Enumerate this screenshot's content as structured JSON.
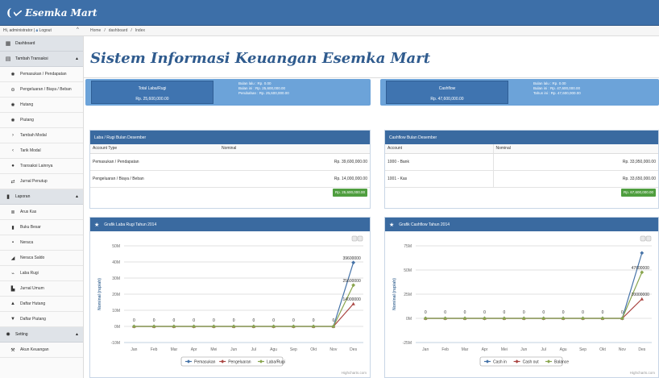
{
  "brand": {
    "bracket": "(",
    "name": "Esemka Mart"
  },
  "topbar": {
    "user_prefix": "Hi, administrator |",
    "logout": "Logout",
    "breadcrumb": [
      "Home",
      "dashboard",
      "Index"
    ]
  },
  "sidebar": {
    "items": [
      {
        "label": "Dashboard",
        "icon": "dashboard-icon",
        "glyph": "▦",
        "kind": "header"
      },
      {
        "label": "Tambah Transaksi",
        "icon": "document-icon",
        "glyph": "▤",
        "kind": "header",
        "caret": "▲"
      },
      {
        "label": "Pemasukan / Pendapatan",
        "icon": "gear-icon",
        "glyph": "✺",
        "kind": "sub"
      },
      {
        "label": "Pengeluaran / Biaya / Beban",
        "icon": "minus-circle-icon",
        "glyph": "⊖",
        "kind": "sub"
      },
      {
        "label": "Hutang",
        "icon": "gear-icon",
        "glyph": "✺",
        "kind": "sub"
      },
      {
        "label": "Piutang",
        "icon": "gear-icon",
        "glyph": "✺",
        "kind": "sub"
      },
      {
        "label": "Tambah Modal",
        "icon": "chevron-right-icon",
        "glyph": "›",
        "kind": "sub"
      },
      {
        "label": "Tarik Modal",
        "icon": "chevron-left-icon",
        "glyph": "‹",
        "kind": "sub"
      },
      {
        "label": "Transaksi Lainnya",
        "icon": "info-circle-icon",
        "glyph": "●",
        "kind": "sub"
      },
      {
        "label": "Jurnal Penutup",
        "icon": "exchange-icon",
        "glyph": "⇄",
        "kind": "sub"
      },
      {
        "label": "Laporan",
        "icon": "document-icon",
        "glyph": "▮",
        "kind": "header",
        "caret": "▲"
      },
      {
        "label": "Arus Kas",
        "icon": "list-icon",
        "glyph": "≣",
        "kind": "sub"
      },
      {
        "label": "Buku Besar",
        "icon": "book-icon",
        "glyph": "▮",
        "kind": "sub"
      },
      {
        "label": "Neraca",
        "icon": "balance-icon",
        "glyph": "▪",
        "kind": "sub"
      },
      {
        "label": "Neraca Saldo",
        "icon": "area-chart-icon",
        "glyph": "◢",
        "kind": "sub"
      },
      {
        "label": "Laba Rugi",
        "icon": "line-chart-icon",
        "glyph": "⌁",
        "kind": "sub"
      },
      {
        "label": "Jurnal Umum",
        "icon": "file-icon",
        "glyph": "▙",
        "kind": "sub"
      },
      {
        "label": "Daftar Hutang",
        "icon": "chevron-up-icon",
        "glyph": "▲",
        "kind": "sub"
      },
      {
        "label": "Daftar Piutang",
        "icon": "chevron-down-icon",
        "glyph": "▼",
        "kind": "sub"
      },
      {
        "label": "Setting",
        "icon": "gear-icon",
        "glyph": "✹",
        "kind": "header",
        "caret": "▲"
      },
      {
        "label": "Akun Keuangan",
        "icon": "tools-icon",
        "glyph": "⚒",
        "kind": "sub"
      }
    ]
  },
  "main": {
    "title": "Sistem Informasi Keuangan Esemka Mart"
  },
  "summary_labarugi": {
    "title": "Total Laba/Rugi",
    "value": "Rp. 25,600,000.00",
    "details": [
      "Bulan lalu : Rp. 0.00",
      "Bulan ini : Rp. 25,600,000.00",
      "Perubahan : Rp. 25,600,000.00"
    ]
  },
  "summary_cashflow": {
    "title": "Cashflow",
    "value": "Rp. 47,600,000.00",
    "details": [
      "Bulan lalu : Rp. 0.00",
      "Bulan ini : Rp. 47,600,000.00",
      "Tahun ini : Rp. 47,600,000.00"
    ]
  },
  "labarugi_table": {
    "heading": "Laba / Rugi Bulan Desember",
    "columns": [
      "Account Type",
      "Nominal"
    ],
    "rows": [
      {
        "account": "Pemasukan / Pendapatan",
        "nominal": "Rp. 39,600,000.00"
      },
      {
        "account": "Pengeluaran / Biaya / Beban",
        "nominal": "Rp. 14,000,000.00"
      }
    ],
    "total": "Rp. 25,600,000.00"
  },
  "cashflow_table": {
    "heading": "Cashflow Bulan Desember",
    "columns": [
      "Account",
      "Nominal"
    ],
    "rows": [
      {
        "account": "1000 - Bank",
        "nominal": "Rp. 33,950,000.00"
      },
      {
        "account": "1001 - Kas",
        "nominal": "Rp. 33,650,000.00"
      }
    ],
    "total": "Rp. 67,600,000.00"
  },
  "chart_labarugi_heading": "Grafik Laba Rugi Tahun 2014",
  "chart_cashflow_heading": "Grafik Cashflow Tahun 2014",
  "colors": {
    "series_blue": "#4572a7",
    "series_red": "#aa4643",
    "series_green": "#89a54e",
    "header_blue": "#3a6aa0"
  },
  "chart_data": [
    {
      "type": "line",
      "title": "",
      "xlabel": "",
      "ylabel": "Nominal (rupiah)",
      "categories": [
        "Jan",
        "Feb",
        "Mar",
        "Apr",
        "Mei",
        "Jun",
        "Jul",
        "Agu",
        "Sep",
        "Okt",
        "Nov",
        "Des"
      ],
      "y_ticks": [
        "-10M",
        "0M",
        "10M",
        "20M",
        "30M",
        "40M",
        "50M"
      ],
      "ylim": [
        -10000000,
        50000000
      ],
      "series": [
        {
          "name": "Pemasukan",
          "values": [
            0,
            0,
            0,
            0,
            0,
            0,
            0,
            0,
            0,
            0,
            0,
            39600000
          ],
          "color": "#4572a7",
          "marker": "diamond"
        },
        {
          "name": "Pengeluaran",
          "values": [
            0,
            0,
            0,
            0,
            0,
            0,
            0,
            0,
            0,
            0,
            0,
            14000000
          ],
          "color": "#aa4643",
          "marker": "triangle"
        },
        {
          "name": "Laba/Rugi",
          "values": [
            0,
            0,
            0,
            0,
            0,
            0,
            0,
            0,
            0,
            0,
            0,
            25600000
          ],
          "color": "#89a54e",
          "marker": "diamond"
        }
      ],
      "point_labels": [
        "0",
        "0",
        "0",
        "0",
        "0",
        "0",
        "0",
        "0",
        "0",
        "0",
        "0",
        "39600000",
        "25600000",
        "14000000"
      ],
      "legend_position": "bottom",
      "credits": "Highcharts.com",
      "grid": true
    },
    {
      "type": "line",
      "title": "",
      "xlabel": "",
      "ylabel": "Nominal (rupiah)",
      "categories": [
        "Jan",
        "Feb",
        "Mar",
        "Apr",
        "Mei",
        "Jun",
        "Jul",
        "Agu",
        "Sep",
        "Okt",
        "Nov",
        "Des"
      ],
      "y_ticks": [
        "-25M",
        "0M",
        "25M",
        "50M",
        "75M"
      ],
      "ylim": [
        -25000000,
        75000000
      ],
      "series": [
        {
          "name": "Cash in",
          "values": [
            0,
            0,
            0,
            0,
            0,
            0,
            0,
            0,
            0,
            0,
            0,
            67600000
          ],
          "color": "#4572a7",
          "marker": "diamond"
        },
        {
          "name": "Cash out",
          "values": [
            0,
            0,
            0,
            0,
            0,
            0,
            0,
            0,
            0,
            0,
            0,
            20000000
          ],
          "color": "#aa4643",
          "marker": "triangle"
        },
        {
          "name": "Balance",
          "values": [
            0,
            0,
            0,
            0,
            0,
            0,
            0,
            0,
            0,
            0,
            0,
            47600000
          ],
          "color": "#89a54e",
          "marker": "diamond"
        }
      ],
      "point_labels": [
        "0",
        "0",
        "0",
        "0",
        "0",
        "0",
        "0",
        "0",
        "0",
        "0",
        "0",
        "47600000",
        "20000000"
      ],
      "legend_position": "bottom",
      "credits": "Highcharts.com",
      "grid": true
    }
  ]
}
